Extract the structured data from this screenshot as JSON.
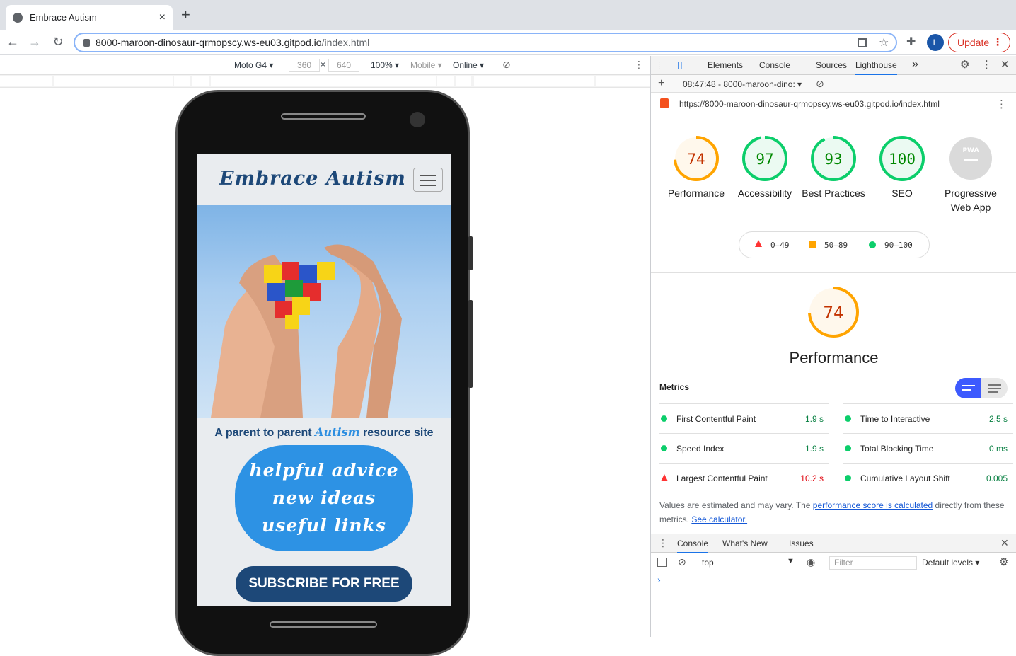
{
  "browser": {
    "tab_title": "Embrace Autism",
    "tab_close": "×",
    "new_tab": "+",
    "url_host": "8000-maroon-dinosaur-qrmopscy.ws-eu03.gitpod.io",
    "url_path": "/index.html",
    "update_label": "Update",
    "avatar_initial": "L"
  },
  "device_toolbar": {
    "device": "Moto G4 ▾",
    "width": "360",
    "times": "×",
    "height": "640",
    "zoom": "100% ▾",
    "mode": "Mobile ▾",
    "network": "Online ▾"
  },
  "site": {
    "brand": "Embrace Autism",
    "tagline_pre": "A parent to parent ",
    "tagline_em": "Autism",
    "tagline_post": " resource site",
    "bubble": [
      "helpful advice",
      "new ideas",
      "useful links"
    ],
    "subscribe": "SUBSCRIBE FOR FREE"
  },
  "devtools": {
    "tabs": [
      "Elements",
      "Console",
      "Sources",
      "Lighthouse"
    ],
    "more": "»",
    "report_time": "08:47:48 - 8000-maroon-dino:",
    "report_url": "https://8000-maroon-dinosaur-qrmopscy.ws-eu03.gitpod.io/index.html",
    "gauges": [
      {
        "score": "74",
        "label": "Performance",
        "color": "#ffa400"
      },
      {
        "score": "97",
        "label": "Accessibility",
        "color": "#0cce6b"
      },
      {
        "score": "93",
        "label": "Best Practices",
        "color": "#0cce6b"
      },
      {
        "score": "100",
        "label": "SEO",
        "color": "#0cce6b"
      },
      {
        "score": "",
        "label": "Progressive Web App",
        "color": "#9e9e9e"
      }
    ],
    "pwa_badge": "PWA",
    "legend": [
      "0–49",
      "50–89",
      "90–100"
    ],
    "perf_score": "74",
    "perf_title": "Performance",
    "metrics_heading": "Metrics",
    "metrics": [
      {
        "name": "First Contentful Paint",
        "value": "1.9 s",
        "status": "good"
      },
      {
        "name": "Time to Interactive",
        "value": "2.5 s",
        "status": "good"
      },
      {
        "name": "Speed Index",
        "value": "1.9 s",
        "status": "good"
      },
      {
        "name": "Total Blocking Time",
        "value": "0 ms",
        "status": "good"
      },
      {
        "name": "Largest Contentful Paint",
        "value": "10.2 s",
        "status": "bad"
      },
      {
        "name": "Cumulative Layout Shift",
        "value": "0.005",
        "status": "good"
      }
    ],
    "note_pre": "Values are estimated and may vary. The ",
    "note_link": "performance score is calculated",
    "note_mid": " directly from these metrics. ",
    "note_link2": "See calculator.",
    "drawer_tabs": [
      "Console",
      "What's New",
      "Issues"
    ],
    "context": "top",
    "filter_placeholder": "Filter",
    "levels": "Default levels ▾",
    "prompt": "›"
  }
}
